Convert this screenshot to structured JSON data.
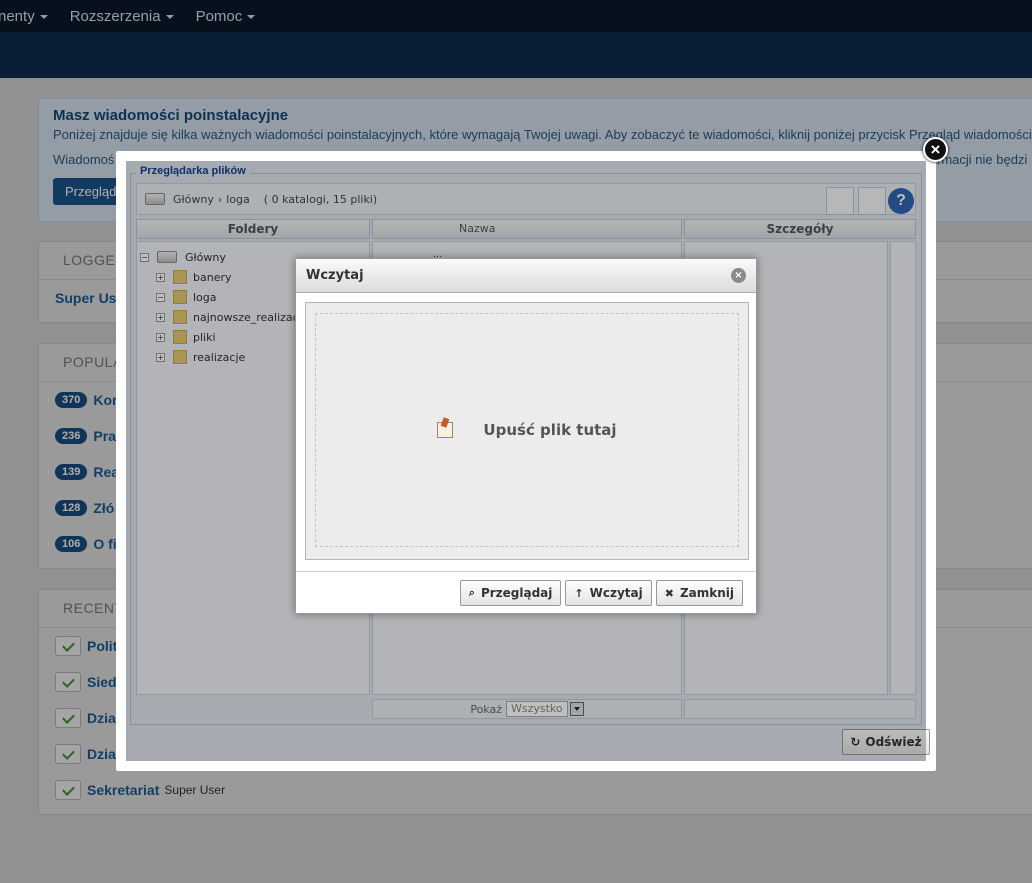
{
  "topnav": {
    "items": [
      {
        "label": "nenty"
      },
      {
        "label": "Rozszerzenia"
      },
      {
        "label": "Pomoc"
      }
    ]
  },
  "alert": {
    "title": "Masz wiadomości poinstalacyjne",
    "line1": "Poniżej znajduje się kilka ważnych wiadomości poinstalacyjnych, które wymagają Twojej uwagi. Aby zobaczyć te wiadomości, kliknij poniżej przycisk Przegląd wiadomości",
    "line2": "Wiadomoś",
    "line2_end": "rmacji nie będzi",
    "button": "Przegląd"
  },
  "logged_panel": {
    "title": "LOGGED",
    "user": "Super Use"
  },
  "popular_panel": {
    "title": "POPULA",
    "items": [
      {
        "count": "370",
        "label": "Kor"
      },
      {
        "count": "236",
        "label": "Pra"
      },
      {
        "count": "139",
        "label": "Rea"
      },
      {
        "count": "128",
        "label": "Złó"
      },
      {
        "count": "106",
        "label": "O fi"
      }
    ]
  },
  "recent_panel": {
    "title": "RECENT",
    "items": [
      {
        "label": "Polit",
        "by": ""
      },
      {
        "label": "Sied",
        "by": ""
      },
      {
        "label": "Dział",
        "by": ""
      },
      {
        "label": "Dzia",
        "by": ""
      },
      {
        "label": "Sekretariat",
        "by": "Super User"
      }
    ]
  },
  "filebrowser": {
    "legend": "Przeglądarka plików",
    "path_root": "Główny",
    "path_sep": "›",
    "path_current": "loga",
    "path_info": "( 0 katalogi, 15 pliki)",
    "folders_header": "Foldery",
    "name_header": "Nazwa",
    "details_header": "Szczegóły",
    "parent_label": "...",
    "tree": [
      {
        "label": "Główny",
        "sign": "−"
      },
      {
        "label": "banery",
        "sign": "+"
      },
      {
        "label": "loga",
        "sign": "−"
      },
      {
        "label": "najnowsze_realizac",
        "sign": "+"
      },
      {
        "label": "pliki",
        "sign": "+"
      },
      {
        "label": "realizacje",
        "sign": "+"
      }
    ],
    "show_label": "Pokaż",
    "show_value": "Wszystko",
    "refresh": "Odśwież",
    "help": "?"
  },
  "dialog": {
    "title": "Wczytaj",
    "drop_text": "Upuść plik tutaj",
    "btn_browse": "Przeglądaj",
    "btn_upload": "Wczytaj",
    "btn_close": "Zamknij"
  },
  "icons": {
    "close_lightbox": "close-circle-icon",
    "dialog_close": "close-small-icon",
    "browse": "search-icon",
    "upload": "arrow-up-icon",
    "close": "x-icon",
    "refresh": "refresh-icon"
  }
}
